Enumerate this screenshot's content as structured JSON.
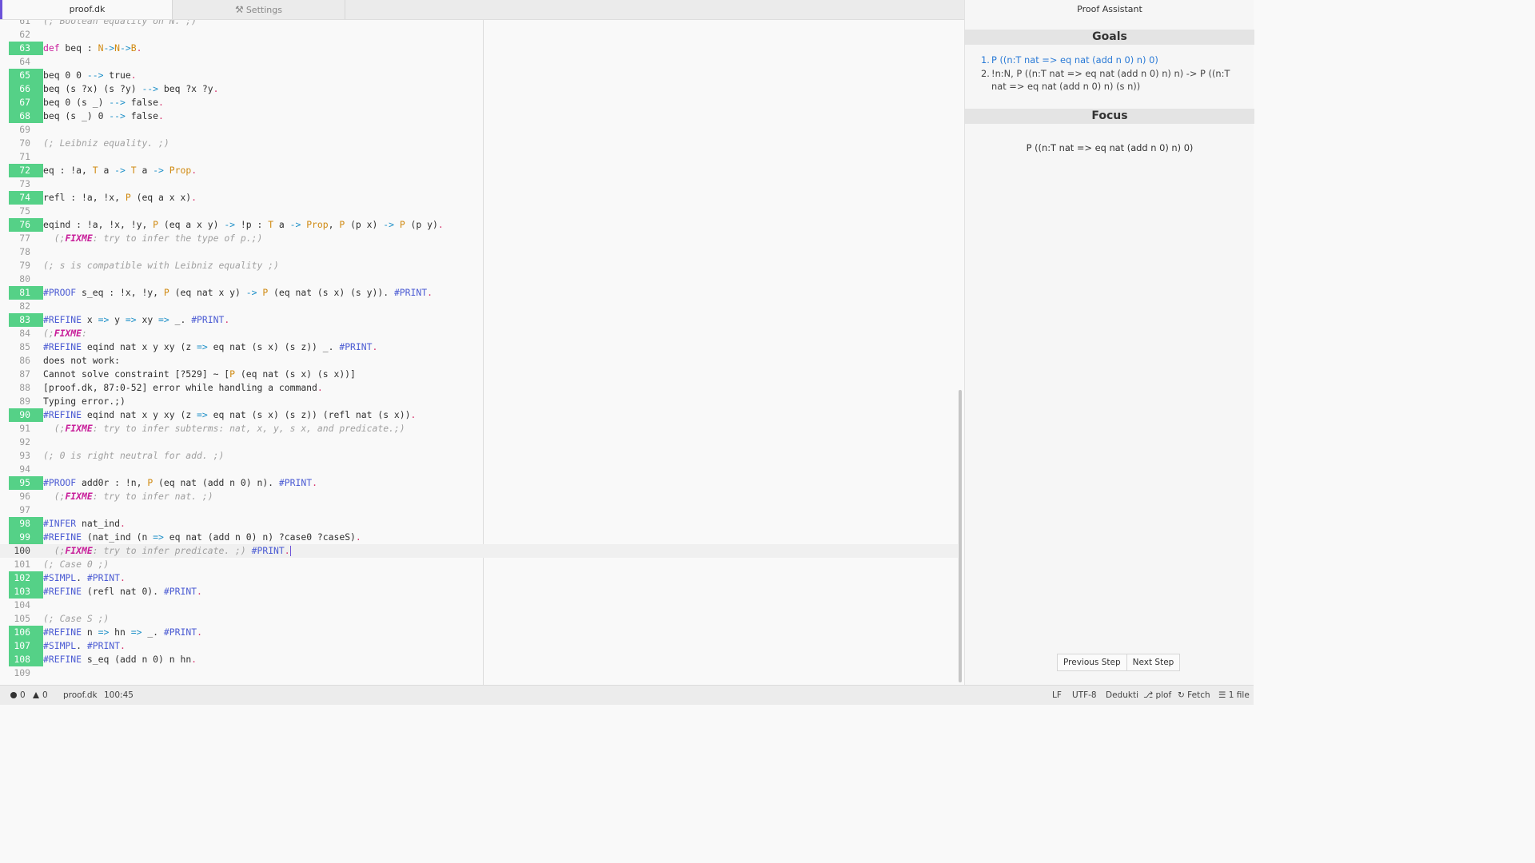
{
  "tabs": [
    {
      "label": "proof.dk",
      "icon": "file-icon"
    },
    {
      "label": "Settings",
      "icon": "tools-icon"
    }
  ],
  "proof_panel": {
    "title": "Proof Assistant",
    "goals_heading": "Goals",
    "goals": [
      {
        "num": "1.",
        "text": "P ((n:T nat => eq nat (add n 0) n) 0)"
      },
      {
        "num": "2.",
        "text": "!n:N, P ((n:T nat => eq nat (add n 0) n) n) -> P ((n:T nat => eq nat (add n 0) n) (s n))"
      }
    ],
    "focus_heading": "Focus",
    "focus_text": "P ((n:T nat => eq nat (add n 0) n) 0)",
    "prev_button": "Previous Step",
    "next_button": "Next Step"
  },
  "status": {
    "errors": "0",
    "warnings": "0",
    "file": "proof.dk",
    "cursor": "100:45",
    "line_ending": "LF",
    "encoding": "UTF-8",
    "grammar": "Dedukti",
    "branch": "plof",
    "fetch": "Fetch",
    "files": "1 file"
  },
  "editor": {
    "top_line_number": "61",
    "top_line_text": "(; Boolean equality on N. ;)",
    "lines": [
      {
        "n": "62",
        "ok": false,
        "code": ""
      },
      {
        "n": "63",
        "ok": true,
        "code": "def beq : N->N->B."
      },
      {
        "n": "64",
        "ok": false,
        "code": ""
      },
      {
        "n": "65",
        "ok": true,
        "code": "beq 0 0 --> true."
      },
      {
        "n": "66",
        "ok": true,
        "code": "beq (s ?x) (s ?y) --> beq ?x ?y."
      },
      {
        "n": "67",
        "ok": true,
        "code": "beq 0 (s _) --> false."
      },
      {
        "n": "68",
        "ok": true,
        "code": "beq (s _) 0 --> false."
      },
      {
        "n": "69",
        "ok": false,
        "code": ""
      },
      {
        "n": "70",
        "ok": false,
        "code": "(; Leibniz equality. ;)"
      },
      {
        "n": "71",
        "ok": false,
        "code": ""
      },
      {
        "n": "72",
        "ok": true,
        "code": "eq : !a, T a -> T a -> Prop."
      },
      {
        "n": "73",
        "ok": false,
        "code": ""
      },
      {
        "n": "74",
        "ok": true,
        "code": "refl : !a, !x, P (eq a x x)."
      },
      {
        "n": "75",
        "ok": false,
        "code": ""
      },
      {
        "n": "76",
        "ok": true,
        "code": "eqind : !a, !x, !y, P (eq a x y) -> !p : T a -> Prop, P (p x) -> P (p y)."
      },
      {
        "n": "77",
        "ok": false,
        "code": "  (;FIXME: try to infer the type of p.;)"
      },
      {
        "n": "78",
        "ok": false,
        "code": ""
      },
      {
        "n": "79",
        "ok": false,
        "code": "(; s is compatible with Leibniz equality ;)"
      },
      {
        "n": "80",
        "ok": false,
        "code": ""
      },
      {
        "n": "81",
        "ok": true,
        "code": "#PROOF s_eq : !x, !y, P (eq nat x y) -> P (eq nat (s x) (s y)). #PRINT."
      },
      {
        "n": "82",
        "ok": false,
        "code": ""
      },
      {
        "n": "83",
        "ok": true,
        "code": "#REFINE x => y => xy => _. #PRINT."
      },
      {
        "n": "84",
        "ok": false,
        "code": "(;FIXME:"
      },
      {
        "n": "85",
        "ok": false,
        "code": "#REFINE eqind nat x y xy (z => eq nat (s x) (s z)) _. #PRINT."
      },
      {
        "n": "86",
        "ok": false,
        "code": "does not work:"
      },
      {
        "n": "87",
        "ok": false,
        "code": "Cannot solve constraint [?529] ~ [P (eq nat (s x) (s x))]"
      },
      {
        "n": "88",
        "ok": false,
        "code": "[proof.dk, 87:0-52] error while handling a command."
      },
      {
        "n": "89",
        "ok": false,
        "code": "Typing error.;)"
      },
      {
        "n": "90",
        "ok": true,
        "code": "#REFINE eqind nat x y xy (z => eq nat (s x) (s z)) (refl nat (s x))."
      },
      {
        "n": "91",
        "ok": false,
        "code": "  (;FIXME: try to infer subterms: nat, x, y, s x, and predicate.;)"
      },
      {
        "n": "92",
        "ok": false,
        "code": ""
      },
      {
        "n": "93",
        "ok": false,
        "code": "(; 0 is right neutral for add. ;)"
      },
      {
        "n": "94",
        "ok": false,
        "code": ""
      },
      {
        "n": "95",
        "ok": true,
        "code": "#PROOF add0r : !n, P (eq nat (add n 0) n). #PRINT."
      },
      {
        "n": "96",
        "ok": false,
        "code": "  (;FIXME: try to infer nat. ;)"
      },
      {
        "n": "97",
        "ok": false,
        "code": ""
      },
      {
        "n": "98",
        "ok": true,
        "code": "#INFER nat_ind."
      },
      {
        "n": "99",
        "ok": true,
        "code": "#REFINE (nat_ind (n => eq nat (add n 0) n) ?case0 ?caseS)."
      },
      {
        "n": "100",
        "ok": false,
        "code": "  (;FIXME: try to infer predicate. ;) #PRINT."
      },
      {
        "n": "101",
        "ok": false,
        "code": "(; Case 0 ;)"
      },
      {
        "n": "102",
        "ok": true,
        "code": "#SIMPL. #PRINT."
      },
      {
        "n": "103",
        "ok": true,
        "code": "#REFINE (refl nat 0). #PRINT."
      },
      {
        "n": "104",
        "ok": false,
        "code": ""
      },
      {
        "n": "105",
        "ok": false,
        "code": "(; Case S ;)"
      },
      {
        "n": "106",
        "ok": true,
        "code": "#REFINE n => hn => _. #PRINT."
      },
      {
        "n": "107",
        "ok": true,
        "code": "#SIMPL. #PRINT."
      },
      {
        "n": "108",
        "ok": true,
        "code": "#REFINE s_eq (add n 0) n hn."
      },
      {
        "n": "109",
        "ok": false,
        "code": ""
      }
    ]
  }
}
